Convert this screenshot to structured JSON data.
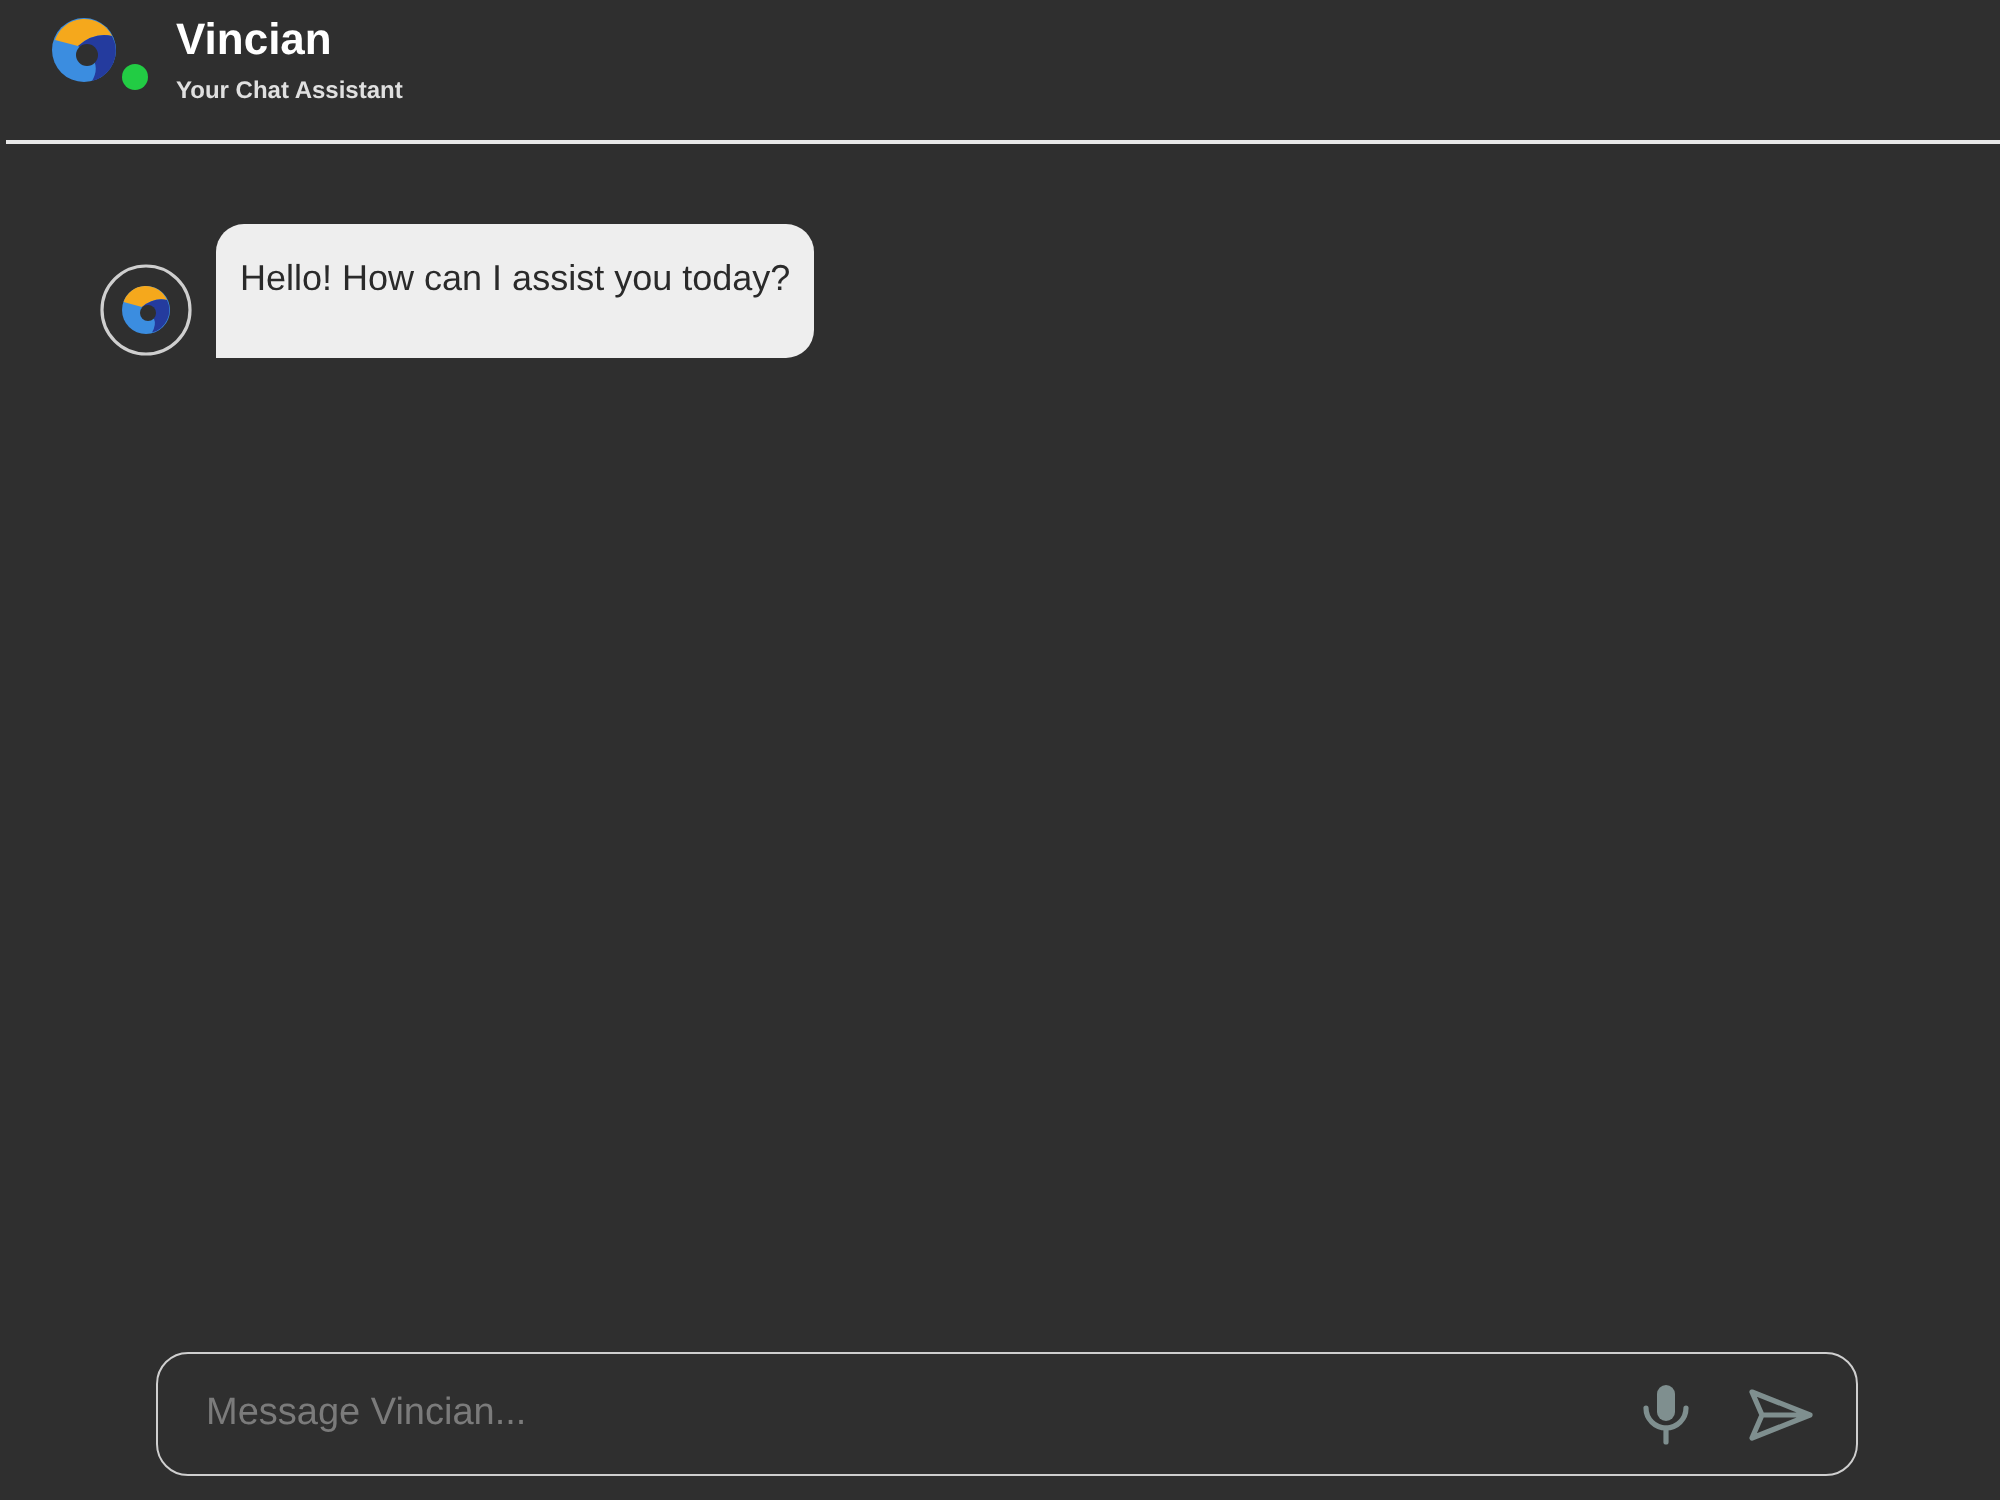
{
  "header": {
    "title": "Vincian",
    "subtitle": "Your Chat Assistant",
    "online": true
  },
  "messages": [
    {
      "kind": "bot",
      "text": "Hello! How can I assist you today?"
    }
  ],
  "composer": {
    "placeholder": "Message Vincian..."
  }
}
